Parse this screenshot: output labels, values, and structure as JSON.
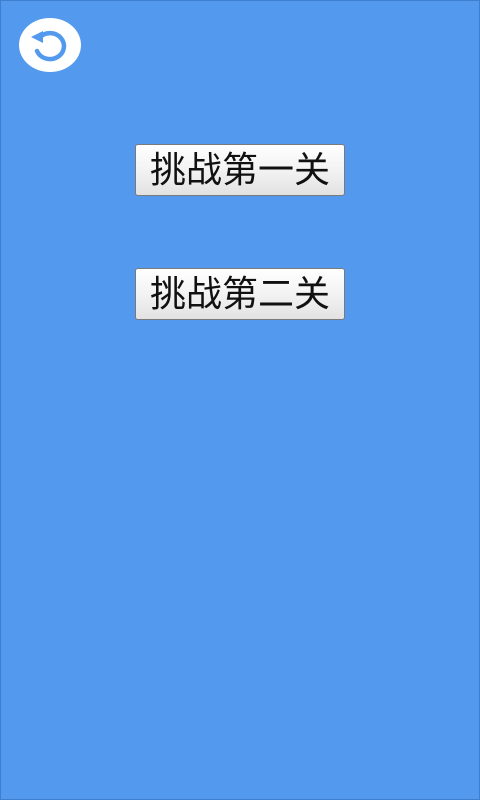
{
  "theme": {
    "background": "#539AEE",
    "button_text": "#111111",
    "back_icon_color": "#539AEE"
  },
  "toolbar": {
    "back_icon": "undo-arrow-icon"
  },
  "levels": [
    {
      "label": "挑战第一关"
    },
    {
      "label": "挑战第二关"
    }
  ]
}
